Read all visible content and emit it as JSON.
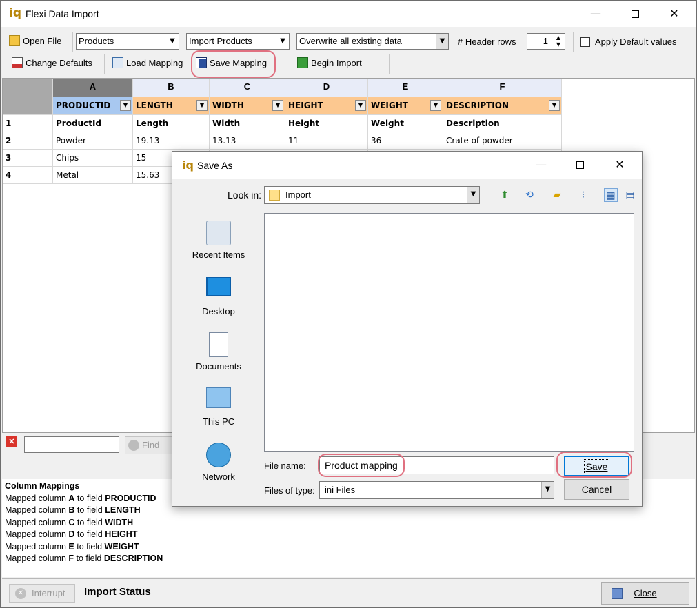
{
  "window": {
    "title": "Flexi Data Import",
    "app_icon": "iq"
  },
  "toolbar": {
    "open_file": "Open File",
    "table_combo": "Products",
    "import_combo": "Import Products",
    "mode_combo": "Overwrite all existing data",
    "header_rows_label": "# Header rows",
    "header_rows_value": "1",
    "apply_defaults": "Apply Default values",
    "change_defaults": "Change Defaults",
    "load_mapping": "Load Mapping",
    "save_mapping": "Save Mapping",
    "begin_import": "Begin Import"
  },
  "grid": {
    "columns": [
      "A",
      "B",
      "C",
      "D",
      "E",
      "F"
    ],
    "mappings": [
      "PRODUCTID",
      "LENGTH",
      "WIDTH",
      "HEIGHT",
      "WEIGHT",
      "DESCRIPTION"
    ],
    "rows": [
      {
        "num": "1",
        "cells": [
          "ProductId",
          "Length",
          "Width",
          "Height",
          "Weight",
          "Description"
        ]
      },
      {
        "num": "2",
        "cells": [
          "Powder",
          "19.13",
          "13.13",
          "11",
          "36",
          "Crate of powder"
        ]
      },
      {
        "num": "3",
        "cells": [
          "Chips",
          "15",
          "",
          "",
          "",
          ""
        ]
      },
      {
        "num": "4",
        "cells": [
          "Metal",
          "15.63",
          "",
          "",
          "",
          ""
        ]
      }
    ]
  },
  "find": {
    "button": "Find"
  },
  "log": {
    "heading": "Column Mappings",
    "lines": [
      {
        "prefix": "Mapped column ",
        "col": "A",
        "mid": " to field ",
        "field": "PRODUCTID"
      },
      {
        "prefix": "Mapped column ",
        "col": "B",
        "mid": " to field ",
        "field": "LENGTH"
      },
      {
        "prefix": "Mapped column ",
        "col": "C",
        "mid": " to field ",
        "field": "WIDTH"
      },
      {
        "prefix": "Mapped column ",
        "col": "D",
        "mid": " to field ",
        "field": "HEIGHT"
      },
      {
        "prefix": "Mapped column ",
        "col": "E",
        "mid": " to field ",
        "field": "WEIGHT"
      },
      {
        "prefix": "Mapped column ",
        "col": "F",
        "mid": " to field ",
        "field": "DESCRIPTION"
      }
    ]
  },
  "status": {
    "interrupt": "Interrupt",
    "label": "Import Status",
    "close": "Close"
  },
  "dialog": {
    "title": "Save As",
    "look_in_label": "Look in:",
    "look_in_value": "Import",
    "places": [
      "Recent Items",
      "Desktop",
      "Documents",
      "This PC",
      "Network"
    ],
    "file_name_label": "File name:",
    "file_name_value": "Product mapping",
    "file_type_label": "Files of type:",
    "file_type_value": "ini Files",
    "save": "Save",
    "cancel": "Cancel"
  },
  "colors": {
    "mapping_bg": "#fcc890",
    "header_bg": "#e8ecf8",
    "highlight": "#e07080"
  }
}
